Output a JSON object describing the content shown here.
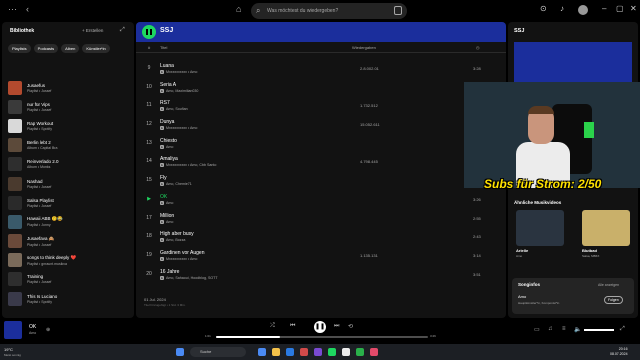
{
  "topbar": {
    "search_placeholder": "Was möchtest du wiedergeben?"
  },
  "sidebar": {
    "title": "Bibliothek",
    "create_label": "Erstellen",
    "chips": [
      "Playlists",
      "Podcasts",
      "Alben",
      "Künstler*in"
    ],
    "items": [
      {
        "name": "Jusaefus",
        "sub": "Playlist • Jussef",
        "color": "#b34a2e"
      },
      {
        "name": "nur für Vips",
        "sub": "Playlist • Jussef",
        "color": "#3a3a3a"
      },
      {
        "name": "Rap Workout",
        "sub": "Playlist • Spotify",
        "color": "#d9d9d9"
      },
      {
        "name": "Berlin lebt 2",
        "sub": "Album • Capital Bra",
        "color": "#5c4a3a"
      },
      {
        "name": "Reinverlado 2.0",
        "sub": "Album • Monks",
        "color": "#2e2e2e"
      },
      {
        "name": "Nashad",
        "sub": "Playlist • Jussef",
        "color": "#4a3a2e"
      },
      {
        "name": "Salsa Playlist",
        "sub": "Playlist • Jussef",
        "color": "#2a2a2a"
      },
      {
        "name": "Hawaii ABB 🙃😂",
        "sub": "Playlist • Jonny",
        "color": "#3a5a6a"
      },
      {
        "name": "Jusaefava 🙈",
        "sub": "Playlist • Jussef",
        "color": "#6a4a3a"
      },
      {
        "name": "songs to think deeply ❤️",
        "sub": "Playlist • gnraunt.musikva",
        "color": "#7a6a5a"
      },
      {
        "name": "Training",
        "sub": "Playlist • Jussef",
        "color": "#2e2e2e"
      },
      {
        "name": "This Is Luciano",
        "sub": "Playlist • Spotify",
        "color": "#3a3a4a"
      }
    ]
  },
  "main": {
    "playlist_title": "SSJ",
    "columns": {
      "number": "#",
      "title": "Titel",
      "plays": "Wiedergaben"
    },
    "tracks": [
      {
        "num": "9",
        "title": "Luana",
        "artist": "Mxxxxxxxxxx • Amo",
        "plays": "2.8.002.01",
        "duration": "3:28",
        "active": false
      },
      {
        "num": "10",
        "title": "Seria A",
        "artist": "Amo, Maximilian030",
        "plays": "",
        "duration": "",
        "active": false
      },
      {
        "num": "11",
        "title": "RS7",
        "artist": "Amo, Soufian",
        "plays": "1.732.512",
        "duration": "",
        "active": false
      },
      {
        "num": "12",
        "title": "Dunya",
        "artist": "Mxxxxxxxxxx • Amo",
        "plays": "15.052.611",
        "duration": "",
        "active": false
      },
      {
        "num": "13",
        "title": "Chiesto",
        "artist": "Amo",
        "plays": "",
        "duration": "",
        "active": false
      },
      {
        "num": "14",
        "title": "Amaliya",
        "artist": "Mxxxxxxxxxx • Amo, Cbb Santo",
        "plays": "4.798.445",
        "duration": "",
        "active": false
      },
      {
        "num": "15",
        "title": "Fly",
        "artist": "Amo, Chemie71",
        "plays": "",
        "duration": "",
        "active": false
      },
      {
        "num": "▶",
        "title": "OK",
        "artist": "Amo",
        "plays": "",
        "duration": "3:26",
        "active": true
      },
      {
        "num": "17",
        "title": "Million",
        "artist": "Amo",
        "plays": "",
        "duration": "2:55",
        "active": false
      },
      {
        "num": "18",
        "title": "High aber busy",
        "artist": "Amo, Bozza",
        "plays": "",
        "duration": "2:43",
        "active": false
      },
      {
        "num": "19",
        "title": "Gardinen vor Augen",
        "artist": "Mxxxxxxxxxx • Amo",
        "plays": "1.135.131",
        "duration": "3:14",
        "active": false
      },
      {
        "num": "20",
        "title": "16 Jahre",
        "artist": "Amo, Sahaoui, Hoodblog, SOTT",
        "plays": "",
        "duration": "3:51",
        "active": false
      }
    ],
    "added_date": "01 Jul. 2024",
    "added_info": "Titel hinzugefügt • 1 Std. 3 Min."
  },
  "right_panel": {
    "title": "SSJ",
    "overlay_text": "Subs für Strom: 2/50",
    "similar_title": "Ähnliche Musikvideos",
    "similar": [
      {
        "name": "Arielle",
        "sub": "Amo",
        "color": "#2a3440"
      },
      {
        "name": "Blutbad",
        "sub": "Salsa, MB6X",
        "color": "#c9b06a"
      }
    ],
    "credits_title": "Songinfos",
    "credits_all": "Alle anzeigen",
    "credits_name": "Amo",
    "credits_sub": "Hauptkünstler*in, Komponist*in",
    "follow_label": "Folgen"
  },
  "player": {
    "title": "OK",
    "artist": "Amo",
    "elapsed": "1:01",
    "total": "3:26",
    "progress": 0.3
  },
  "taskbar": {
    "weather_temp": "19°C",
    "weather_desc": "Meist sonnig",
    "search_label": "Suche",
    "time": "20:16",
    "date": "08.07.2024",
    "app_colors": [
      "#4a8af4",
      "#f4c24a",
      "#2a7ae2",
      "#d24a4a",
      "#7a4ad2",
      "#1ed760",
      "#ececec",
      "#2ab04a",
      "#e24a6a"
    ]
  },
  "colors": {
    "accent": "#1ed760",
    "header_blue": "#1b2e9c",
    "overlay_yellow": "#ffe100"
  }
}
